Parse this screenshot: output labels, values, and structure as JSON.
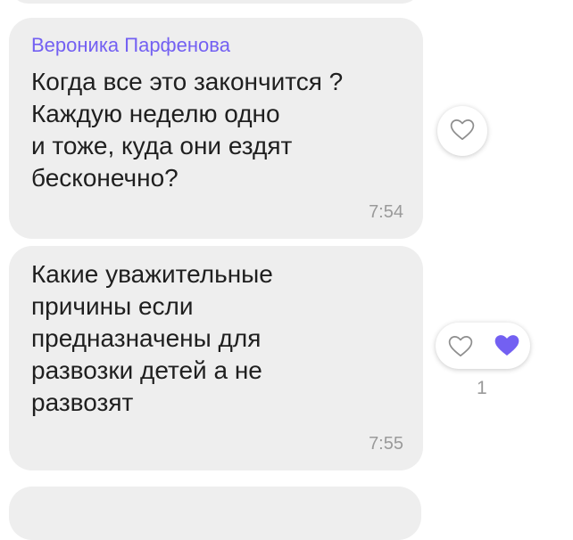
{
  "messages": [
    {
      "sender": "Вероника Парфенова",
      "text": "Когда все это закончится ?\nКаждую неделю одно\nи тоже, куда они ездят\nбесконечно?",
      "time": "7:54"
    },
    {
      "text": "Какие уважительные\nпричины если\nпредназначены для\nразвозки детей а не\nразвозят",
      "time": "7:55",
      "like_count": "1"
    }
  ],
  "icons": {
    "like_empty": "heart-outline-icon",
    "like_filled": "heart-filled-icon"
  },
  "colors": {
    "accent": "#7360f2",
    "bubble": "#eeeeee",
    "text": "#1f1f1f",
    "muted": "#9a9a9a"
  }
}
